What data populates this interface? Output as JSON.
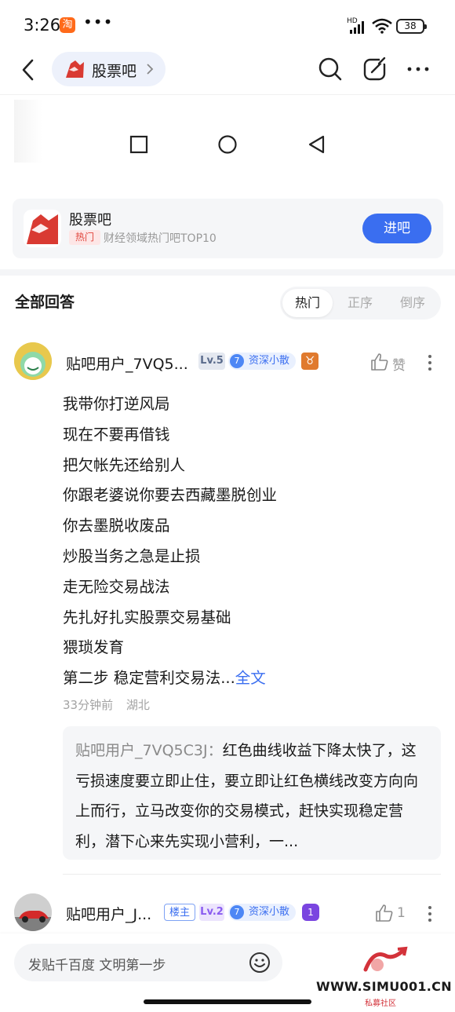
{
  "status_bar": {
    "time": "3:26",
    "app_badge": "淘",
    "dots": "•••",
    "network": "HD",
    "battery": "38"
  },
  "nav": {
    "forum_name": "股票吧"
  },
  "bar_card": {
    "title": "股票吧",
    "tag": "热门",
    "subtitle": "财经领域热门吧TOP10",
    "join_label": "进吧"
  },
  "answers": {
    "title": "全部回答",
    "sort_tabs": [
      {
        "label": "热门",
        "active": true
      },
      {
        "label": "正序",
        "active": false
      },
      {
        "label": "倒序",
        "active": false
      }
    ]
  },
  "post": {
    "username": "贴吧用户_7VQ5...",
    "level": "Lv.5",
    "title_level": "7",
    "title_badge": "资深小散",
    "zodiac": "♉",
    "like_label": "赞",
    "lines": [
      "我带你打逆风局",
      "现在不要再借钱",
      "把欠帐先还给别人",
      "你跟老婆说你要去西藏墨脱创业",
      "你去墨脱收废品",
      "炒股当务之急是止损",
      "走无险交易战法",
      "先扎好扎实股票交易基础",
      "猥琐发育"
    ],
    "last_line": "第二步 稳定营利交易法...",
    "full_text_label": "全文",
    "time": "33分钟前",
    "location": "湖北",
    "quote_author": "贴吧用户_7VQ5C3J：",
    "quote_text": "红色曲线收益下降太快了，这亏损速度要立即止住，要立即让红色横线改变方向向上而行，立马改变你的交易模式，赶快实现稳定营利，潜下心来先实现小营利，一..."
  },
  "post2": {
    "username": "贴吧用户_J...",
    "owner_badge": "楼主",
    "level": "Lv.2",
    "title_level": "7",
    "title_badge": "资深小散",
    "medal": "1",
    "like_count": "1"
  },
  "composer": {
    "placeholder": "发贴千百度 文明第一步"
  },
  "watermark": {
    "domain": "WWW.SIMU001.CN",
    "caption": "私募社区"
  },
  "colors": {
    "accent": "#3a6ef0",
    "hot_tag": "#e0443b",
    "level5": "#5a6b8c",
    "level2": "#8a5cf0"
  }
}
